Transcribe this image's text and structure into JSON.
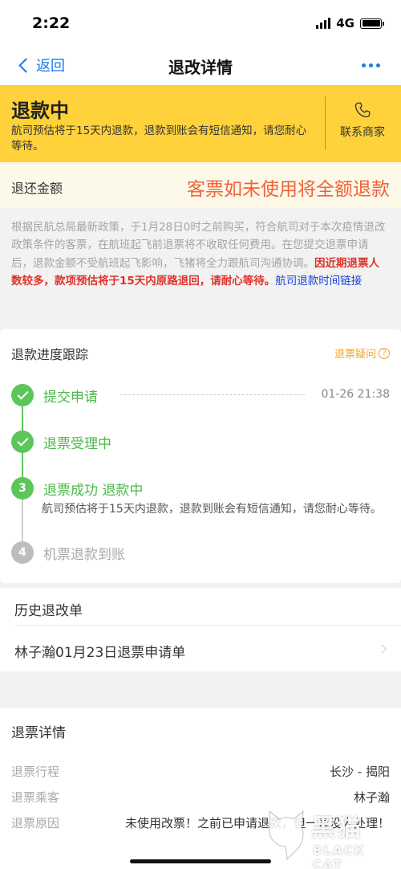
{
  "status_bar": {
    "time": "2:22",
    "network": "4G"
  },
  "nav": {
    "back_label": "返回",
    "title": "退改详情",
    "more_icon": "ellipsis-icon"
  },
  "banner": {
    "status_title": "退款中",
    "description": "航司预估将于15天内退款，退款到账会有短信通知，请您耐心等待。",
    "contact_label": "联系商家",
    "contact_icon": "phone-icon",
    "background_color": "#ffd23b"
  },
  "refund_amount": {
    "label": "退还金额",
    "note": "客票如未使用将全额退款",
    "note_color": "#f0623a"
  },
  "notice": {
    "text_gray": "根据民航总局最新政策，于1月28日0时之前购买，符合航司对于本次疫情退改政策条件的客票，在航班起飞前退票将不收取任何费用。在您提交退票申请后，退款金额不受航班起飞影响，飞猪将全力跟航司沟通协调。",
    "text_red": "因近期退票人数较多，款项预估将于15天内原路退回，请耐心等待。",
    "link_text": "航司退款时间链接"
  },
  "progress": {
    "title": "退款进度跟踪",
    "help_label": "退票疑问",
    "help_icon": "question-circle-icon",
    "steps": [
      {
        "label": "提交申请",
        "status": "done",
        "time": "01-26 21:38"
      },
      {
        "label": "退票受理中",
        "status": "done"
      },
      {
        "number": "3",
        "label": "退票成功 退款中",
        "status": "current",
        "description": "航司预估将于15天内退款，退款到账会有短信通知，请您耐心等待。"
      },
      {
        "number": "4",
        "label": "机票退款到账",
        "status": "pending"
      }
    ],
    "done_color": "#5cc65a"
  },
  "history": {
    "title": "历史退改单",
    "item": "林子瀚01月23日退票申请单"
  },
  "detail": {
    "title": "退票详情",
    "rows": [
      {
        "label": "退票行程",
        "value": "长沙 - 揭阳"
      },
      {
        "label": "退票乘客",
        "value": "林子瀚"
      },
      {
        "label": "退票原因",
        "value": "未使用改票！之前已申请退款，但一直没人处理！"
      }
    ]
  },
  "watermark": {
    "text": "黑猫",
    "sub": "BLACK CAT"
  }
}
